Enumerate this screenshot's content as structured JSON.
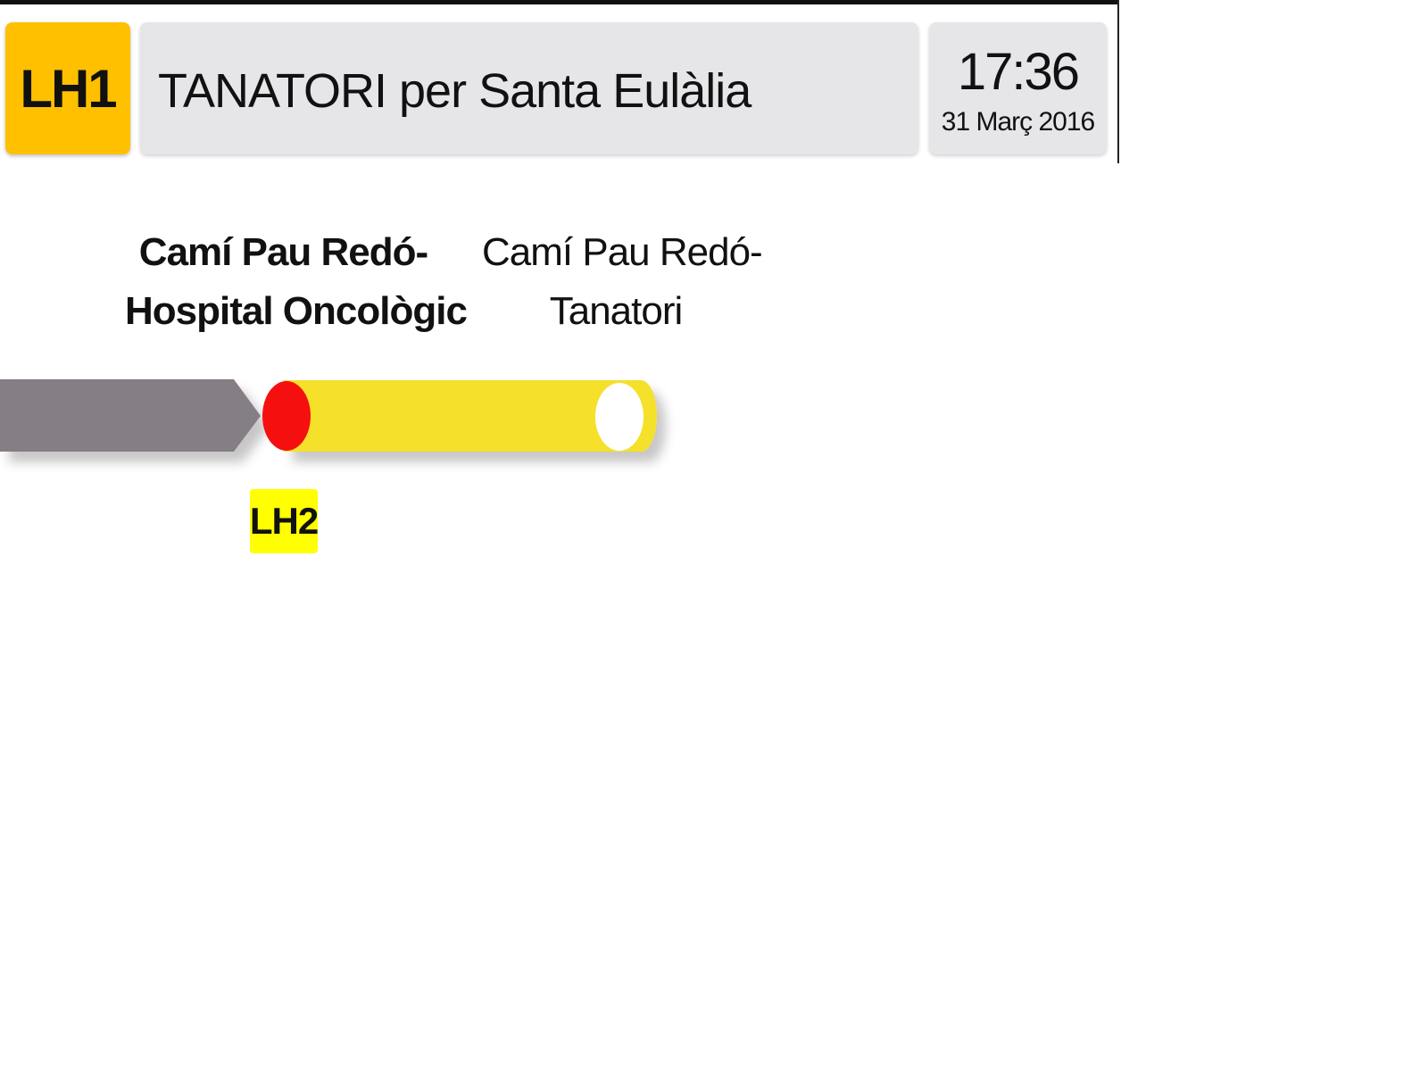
{
  "header": {
    "line_code": "LH1",
    "destination": "TANATORI per Santa Eulàlia",
    "time": "17:36",
    "date": "31 Març 2016"
  },
  "stops": {
    "current": {
      "line1": "Camí Pau Redó-",
      "line2": "Hospital Oncològic"
    },
    "next": {
      "line1": "Camí Pau Redó-",
      "line2": "Tanatori"
    }
  },
  "connections": [
    "LH2"
  ],
  "colors": {
    "line_badge": "#FFC000",
    "travelled_segment": "#857E85",
    "upcoming_segment": "#F5E02A",
    "current_stop_marker": "#F50F0F",
    "next_stop_marker": "#FFFFFF",
    "connection_badge": "#FFFF00",
    "panel_background": "#E6E6E9"
  },
  "icons": {
    "current_stop": "current-stop-marker-icon",
    "next_stop": "next-stop-marker-icon"
  }
}
